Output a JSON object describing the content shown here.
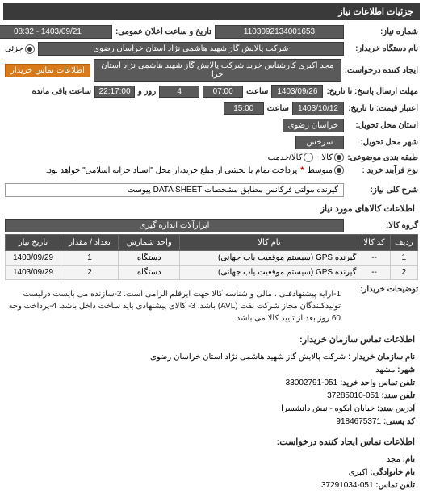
{
  "header": "جزئیات اطلاعات نیاز",
  "req_number": {
    "label": "شماره نیاز:",
    "value": "1103092134001653"
  },
  "announce": {
    "label": "تاریخ و ساعت اعلان عمومی:",
    "value": "1403/09/21 - 08:32"
  },
  "buyer_org": {
    "label": "نام دستگاه خریدار:",
    "value": "شرکت پالایش گاز شهید هاشمی نژاد    استان خراسان رضوی"
  },
  "partial": {
    "label": "جزئی",
    "checked": true
  },
  "requester": {
    "label": "ایجاد کننده درخواست:",
    "value": "مجد اکبری کارشناس خرید شرکت پالایش گاز شهید هاشمی نژاد    استان خرا"
  },
  "buyer_contact_btn": "اطلاعات تماس خریدار",
  "respond_until": {
    "label": "مهلت ارسال پاسخ: تا تاریخ:",
    "date": "1403/09/26",
    "time_label": "ساعت",
    "time": "07:00",
    "days_label": "روز و",
    "days": "4",
    "remain_label": "ساعت باقی مانده",
    "remain": "22:17:00"
  },
  "price_until": {
    "label": "اعتبار قیمت: تا تاریخ:",
    "date": "1403/10/12",
    "time_label": "ساعت",
    "time": "15:00"
  },
  "delivery_province": {
    "label": "استان محل تحویل:",
    "value": "خراسان رضوی"
  },
  "delivery_city": {
    "label": "شهر محل تحویل:",
    "value": "سرخس"
  },
  "classification": {
    "label": "طبقه بندی موضوعی:",
    "options": [
      {
        "label": "کالا",
        "checked": true
      },
      {
        "label": "کالا/خدمت",
        "checked": false
      }
    ]
  },
  "purchase_type": {
    "label": "نوع فرآیند خرید :",
    "options": [
      {
        "label": "متوسط",
        "checked": true
      }
    ],
    "note_label": "*",
    "note": "پرداخت تمام یا بخشی از مبلغ خرید،از محل \"اسناد خزانه اسلامی\" خواهد بود."
  },
  "need_desc": {
    "label": "شرح کلی نیاز:",
    "value": "گیرنده مولتی فرکانس مطابق مشخصات DATA SHEET پیوست"
  },
  "goods_header": "اطلاعات کالاهای مورد نیاز",
  "goods_group": {
    "label": "گروه کالا:",
    "value": "ابزارآلات اندازه گیری"
  },
  "table": {
    "headers": [
      "ردیف",
      "کد کالا",
      "نام کالا",
      "واحد شمارش",
      "تعداد / مقدار",
      "تاریخ نیاز"
    ],
    "rows": [
      {
        "idx": "1",
        "code": "--",
        "name": "گیرنده GPS (سیستم موقعیت یاب جهانی)",
        "unit": "دستگاه",
        "qty": "1",
        "date": "1403/09/29"
      },
      {
        "idx": "2",
        "code": "--",
        "name": "گیرنده GPS (سیستم موقعیت یاب جهانی)",
        "unit": "دستگاه",
        "qty": "2",
        "date": "1403/09/29"
      }
    ]
  },
  "buyer_notes": {
    "label": "توضیحات خریدار:",
    "text": "1-ارایه پیشنهادفنی ، مالی و شناسه کالا جهت ایرقلم الزامی است. 2-سازنده می بایست درلیست تولیدکنندگان مجاز شرکت نفت (AVL) باشد. 3- کالای پیشنهادی باید ساخت داخل باشد. 4-پرداخت وجه 60 روز بعد از تایید کالا می باشد."
  },
  "contact_header": "اطلاعات تماس سازمان خریدار:",
  "contact": {
    "org": {
      "label": "نام سازمان خریدار :",
      "value": "شرکت پالایش گاز شهید هاشمی نژاد استان خراسان رضوی"
    },
    "city": {
      "label": "شهر:",
      "value": "مشهد"
    },
    "buy_phone": {
      "label": "تلفن تماس واحد خرید:",
      "value": "051-33002791"
    },
    "pub_phone": {
      "label": "تلفن سند:",
      "value": "051-37285010"
    },
    "address": {
      "label": "آدرس سند:",
      "value": "خیابان آبکوه - نبش دانشسرا"
    },
    "postal": {
      "label": "کد پستی:",
      "value": "9184675371"
    }
  },
  "requester_contact_header": "اطلاعات تماس ایجاد کننده درخواست:",
  "requester_contact": {
    "name": {
      "label": "نام:",
      "value": "مجد"
    },
    "family": {
      "label": "نام خانوادگی:",
      "value": "اکبری"
    },
    "phone": {
      "label": "تلفن تماس:",
      "value": "051-37291034"
    }
  }
}
